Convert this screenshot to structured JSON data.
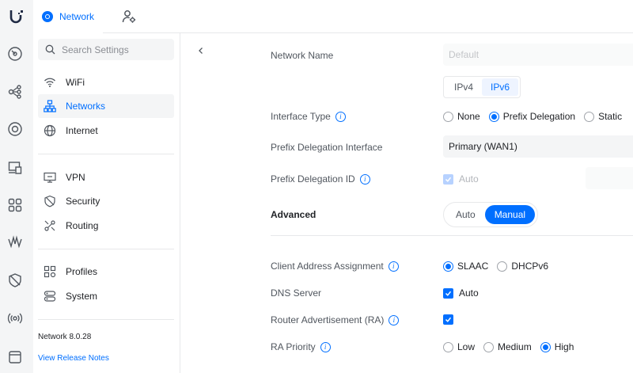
{
  "app": {
    "tab_label": "Network",
    "colors": {
      "accent": "#006fff",
      "rail_bg": "#f4f5f6",
      "border": "#e7e8ea"
    }
  },
  "rail_icons": [
    "dashboard-icon",
    "topology-icon",
    "clients-icon",
    "devices-icon",
    "apps-icon",
    "insights-icon",
    "protect-icon",
    "radio-icon",
    "settings-icon"
  ],
  "sidebar": {
    "search_placeholder": "Search Settings",
    "items": [
      {
        "label": "WiFi",
        "icon": "wifi-icon",
        "active": false
      },
      {
        "label": "Networks",
        "icon": "networks-icon",
        "active": true
      },
      {
        "label": "Internet",
        "icon": "globe-icon",
        "active": false
      },
      {
        "label": "VPN",
        "icon": "vpn-icon",
        "active": false
      },
      {
        "label": "Security",
        "icon": "shield-icon",
        "active": false
      },
      {
        "label": "Routing",
        "icon": "routing-icon",
        "active": false
      },
      {
        "label": "Profiles",
        "icon": "profiles-icon",
        "active": false
      },
      {
        "label": "System",
        "icon": "system-icon",
        "active": false
      }
    ],
    "version": "Network 8.0.28",
    "release_notes": "View Release Notes"
  },
  "form": {
    "network_name": {
      "label": "Network Name",
      "placeholder": "Default"
    },
    "ip_tabs": [
      {
        "label": "IPv4",
        "selected": false
      },
      {
        "label": "IPv6",
        "selected": true
      }
    ],
    "interface_type": {
      "label": "Interface Type",
      "options": [
        {
          "label": "None",
          "selected": false
        },
        {
          "label": "Prefix Delegation",
          "selected": true
        },
        {
          "label": "Static",
          "selected": false
        }
      ]
    },
    "prefix_delegation_interface": {
      "label": "Prefix Delegation Interface",
      "value": "Primary (WAN1)"
    },
    "prefix_delegation_id": {
      "label": "Prefix Delegation ID",
      "checkbox_label": "Auto",
      "checked": true,
      "disabled": true
    },
    "advanced": {
      "label": "Advanced",
      "options": [
        {
          "label": "Auto",
          "selected": false
        },
        {
          "label": "Manual",
          "selected": true
        }
      ]
    },
    "client_address_assignment": {
      "label": "Client Address Assignment",
      "options": [
        {
          "label": "SLAAC",
          "selected": true
        },
        {
          "label": "DHCPv6",
          "selected": false
        }
      ]
    },
    "dns_server": {
      "label": "DNS Server",
      "checkbox_label": "Auto",
      "checked": true
    },
    "router_advertisement": {
      "label": "Router Advertisement (RA)",
      "checked": true
    },
    "ra_priority": {
      "label": "RA Priority",
      "options": [
        {
          "label": "Low",
          "selected": false
        },
        {
          "label": "Medium",
          "selected": false
        },
        {
          "label": "High",
          "selected": true
        }
      ]
    }
  }
}
